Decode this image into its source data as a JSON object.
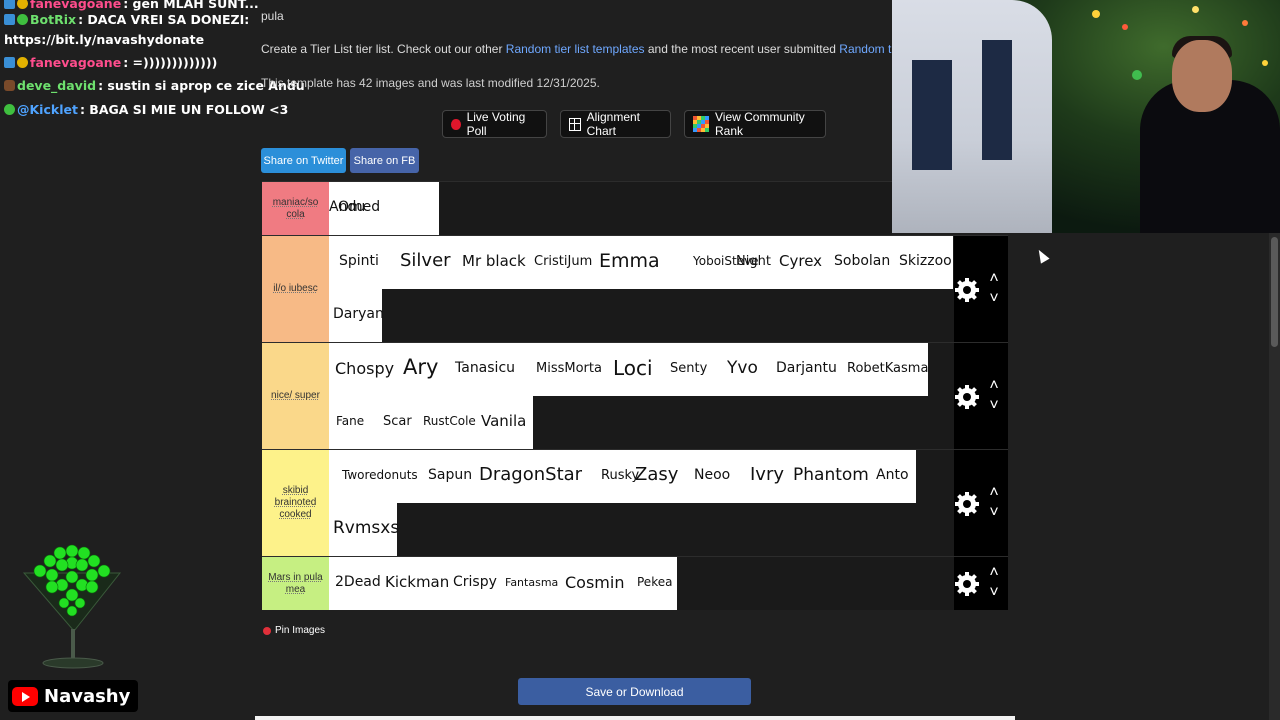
{
  "chat": [
    {
      "name": "fanevagoane",
      "name_color": "#ff4d8d",
      "text": ": gen MLAH SUNT...",
      "badges": [
        "b-blue",
        "b-gold"
      ]
    },
    {
      "name": "BotRix",
      "name_color": "#6ee06e",
      "text": ": DACA VREI SA DONEZI:",
      "text2": "https://bit.ly/navashydonate",
      "badges": [
        "b-blue",
        "b-green"
      ]
    },
    {
      "name": "fanevagoane",
      "name_color": "#ff4d8d",
      "text": ": =)))))))))))))",
      "badges": [
        "b-blue",
        "b-gold"
      ]
    },
    {
      "name": "deve_david",
      "name_color": "#6ee06e",
      "text": ": sustin si aprop ce zice Andu",
      "badges": [
        "b-brown"
      ]
    },
    {
      "name": "@Kicklet",
      "name_color": "#4fa3ff",
      "text": ": BAGA SI MIE UN FOLLOW <3",
      "badges": [
        "b-green"
      ]
    }
  ],
  "page": {
    "title": "pula",
    "desc_prefix": "Create a Tier List tier list. Check out our other ",
    "desc_link1": "Random tier list templates",
    "desc_middle": " and the most recent user submitted ",
    "desc_link2": "Random tier lists",
    "meta": "This template has 42 images and was last modified 12/31/2025."
  },
  "toolbar": {
    "live_voting": "Live Voting Poll",
    "alignment": "Alignment Chart",
    "community": "View Community Rank"
  },
  "share": {
    "twitter": "Share on Twitter",
    "fb": "Share on FB"
  },
  "tiers": [
    {
      "label": "maniac/so cola",
      "color": "#f07b82",
      "items": [
        [
          "Omed",
          14
        ],
        [
          "Andu",
          14
        ]
      ]
    },
    {
      "label": "il/o iubesc",
      "color": "#f7ba86",
      "items": [
        [
          "Spinti",
          14
        ],
        [
          "Silver",
          18
        ],
        [
          "Mr black",
          15
        ],
        [
          "CristiJum",
          13
        ],
        [
          "Emma",
          19
        ],
        [
          "YoboiSteve",
          12
        ],
        [
          "Night",
          13
        ],
        [
          "Cyrex",
          15
        ],
        [
          "Sobolan",
          14
        ],
        [
          "Skizzoo",
          14
        ],
        [
          "Daryan",
          14
        ]
      ]
    },
    {
      "label": "nice/ super",
      "color": "#fad88a",
      "items": [
        [
          "Chospy",
          16
        ],
        [
          "Ary",
          21
        ],
        [
          "Tanasicu",
          14
        ],
        [
          "MissMorta",
          13
        ],
        [
          "Loci",
          20
        ],
        [
          "Senty",
          13
        ],
        [
          "Yvo",
          17
        ],
        [
          "Darjantu",
          14
        ],
        [
          "RobetKasma",
          13
        ],
        [
          "Fane",
          12
        ],
        [
          "Scar",
          13
        ],
        [
          "RustCole",
          12
        ],
        [
          "Vanila",
          15
        ]
      ]
    },
    {
      "label": "skibid brainoted cooked",
      "color": "#fdf28a",
      "items": [
        [
          "Tworedonuts",
          12
        ],
        [
          "Sapun",
          14
        ],
        [
          "DragonStar",
          18
        ],
        [
          "Rusky",
          13
        ],
        [
          "Zasy",
          18
        ],
        [
          "Neoo",
          14
        ],
        [
          "Ivry",
          18
        ],
        [
          "Phantom",
          17
        ],
        [
          "Anto",
          14
        ],
        [
          "Rvmsxs",
          17
        ]
      ]
    },
    {
      "label": "Mars in pula mea",
      "color": "#c6ef82",
      "items": [
        [
          "2Dead",
          14
        ],
        [
          "Kickman",
          15
        ],
        [
          "Crispy",
          14
        ],
        [
          "Fantasma",
          11
        ],
        [
          "Cosmin",
          16
        ],
        [
          "Pekea",
          12
        ]
      ]
    }
  ],
  "pin_label": "Pin Images",
  "save_label": "Save or Download",
  "channel_name": "Navashy",
  "icons": {
    "live": "record-dot-icon",
    "alignment": "grid-icon",
    "community": "mosaic-icon",
    "settings": "gear-icon",
    "up": "chevron-up-icon",
    "down": "chevron-down-icon",
    "pin": "pin-icon",
    "youtube": "youtube-icon"
  }
}
